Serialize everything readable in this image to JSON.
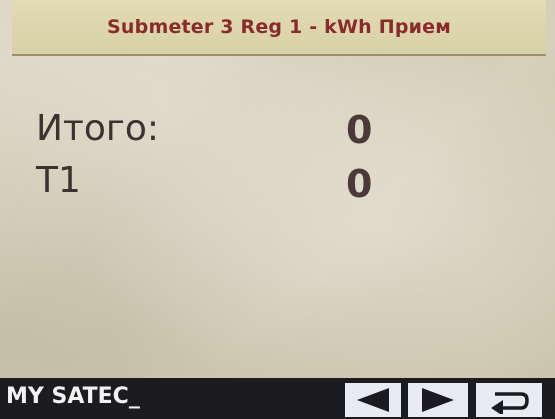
{
  "header": {
    "title": "Submeter 3 Reg 1 - kWh Прием"
  },
  "readings": [
    {
      "label": "Итого:",
      "value": "0"
    },
    {
      "label": "T1",
      "value": "0"
    }
  ],
  "status_bar": {
    "device_name": "MY SATEC_"
  },
  "nav": {
    "prev_icon": "left-arrow-icon",
    "next_icon": "right-arrow-icon",
    "back_icon": "return-icon"
  },
  "colors": {
    "title_text": "#8a2b2b",
    "screen_bg": "#d4ceb8",
    "status_bar_bg": "#1c1c20",
    "nav_icon": "#1c1c20"
  }
}
